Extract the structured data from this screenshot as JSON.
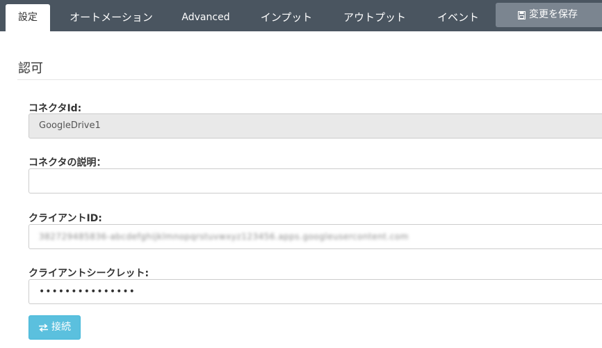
{
  "tabs": [
    {
      "label": "設定"
    },
    {
      "label": "オートメーション"
    },
    {
      "label": "Advanced"
    },
    {
      "label": "インプット"
    },
    {
      "label": "アウトプット"
    },
    {
      "label": "イベント"
    }
  ],
  "save_button": {
    "label": "変更を保存",
    "icon": "save-icon"
  },
  "section": {
    "title": "認可"
  },
  "form": {
    "connector_id": {
      "label": "コネクタId:",
      "value": "GoogleDrive1"
    },
    "connector_description": {
      "label": "コネクタの説明：",
      "value": ""
    },
    "client_id": {
      "label": "クライアントID:",
      "value": "382729485836-abcdefghijklmnopqrstuvwxyz123456.apps.googleusercontent.com"
    },
    "client_secret": {
      "label": "クライアントシークレット:",
      "value": "•••••••••••••••"
    }
  },
  "connect_button": {
    "label": "接続",
    "icon": "exchange-icon"
  },
  "colors": {
    "topbar": "#4a5560",
    "save_button": "#7b8590",
    "connect_button": "#5bc0de"
  }
}
